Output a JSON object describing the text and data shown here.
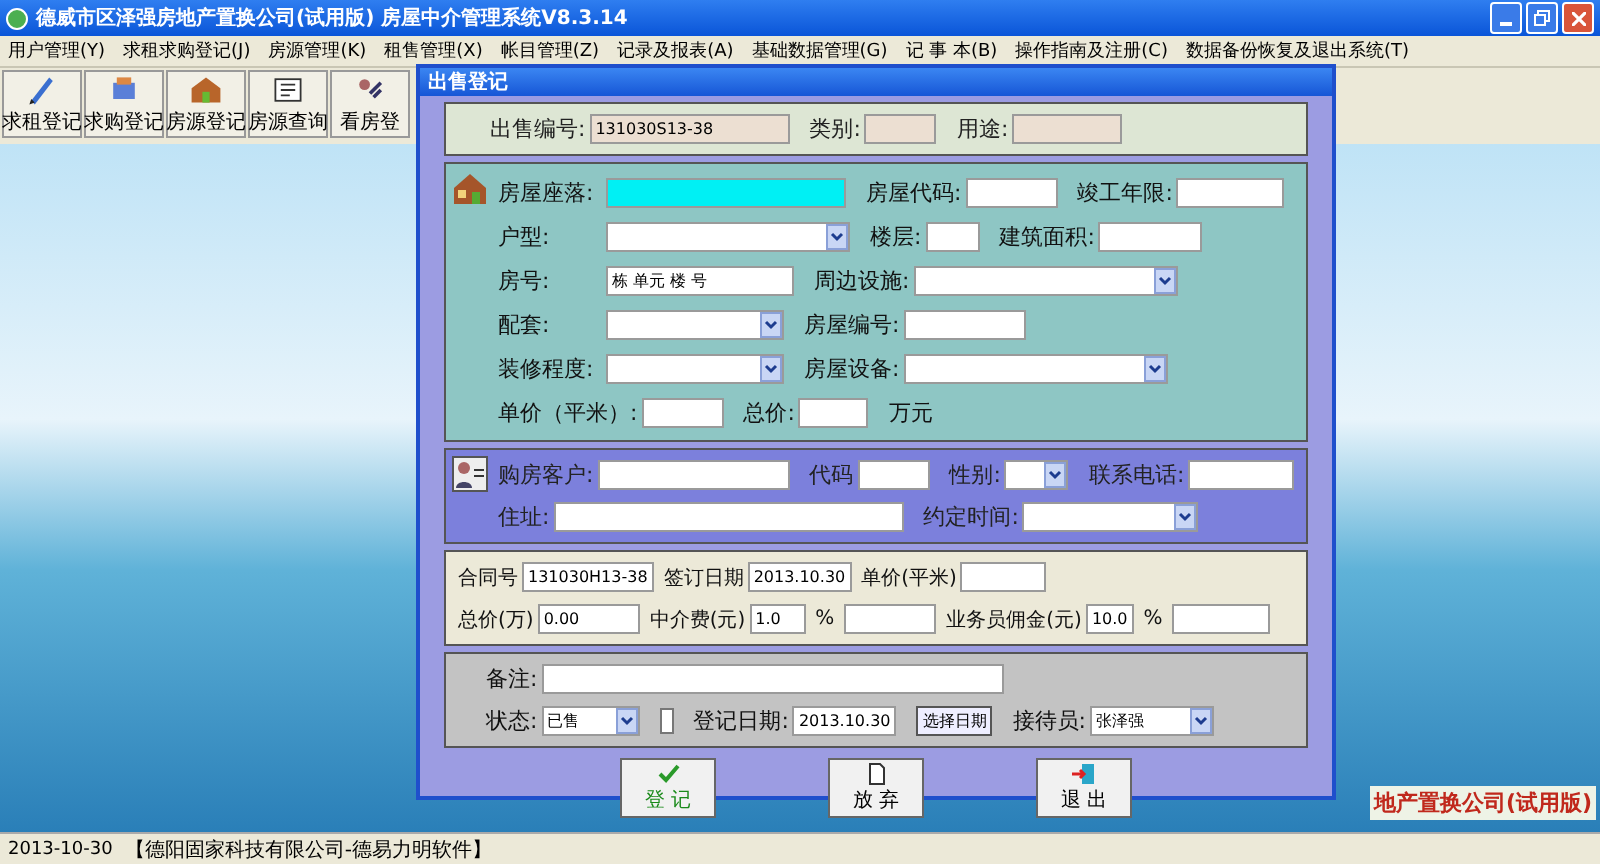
{
  "window": {
    "title": "德威市区泽强房地产置换公司(试用版) 房屋中介管理系统V8.3.14"
  },
  "menu": [
    "用户管理(Y)",
    "求租求购登记(J)",
    "房源管理(K)",
    "租售管理(X)",
    "帐目管理(Z)",
    "记录及报表(A)",
    "基础数据管理(G)",
    "记 事 本(B)",
    "操作指南及注册(C)",
    "数据备份恢复及退出系统(T)"
  ],
  "toolbar": [
    "求租登记",
    "求购登记",
    "房源登记",
    "房源查询",
    "看房登"
  ],
  "banner": "地产置换公司(试用版)",
  "dialog": {
    "title": "出售登记",
    "sections": [
      {
        "kind": "header",
        "lines": [
          [
            {
              "kind": "field",
              "label": "出售编号:",
              "value": "131030S13-38",
              "focused": false
            },
            {
              "kind": "field",
              "label": "类别:",
              "focused": false
            },
            {
              "kind": "field",
              "label": "用途:",
              "focused": false
            }
          ]
        ]
      },
      {
        "kind": "house",
        "lines": [
          [
            {
              "kind": "field",
              "label": "房屋座落:",
              "focused": true
            },
            {
              "kind": "field",
              "label": "房屋代码:",
              "focused": false
            },
            {
              "kind": "field",
              "label": "竣工年限:",
              "focused": false
            }
          ],
          [
            {
              "kind": "combo",
              "label": "户型:"
            },
            {
              "kind": "field",
              "label": "楼层:",
              "focused": false
            },
            {
              "kind": "field",
              "label": "建筑面积:",
              "focused": false
            }
          ],
          [
            {
              "kind": "field",
              "label": "房号:",
              "value": "栋 单元 楼 号",
              "focused": false
            },
            {
              "kind": "combo",
              "label": "周边设施:"
            }
          ],
          [
            {
              "kind": "combo",
              "label": "配套:"
            },
            {
              "kind": "field",
              "label": "房屋编号:",
              "focused": false
            }
          ],
          [
            {
              "kind": "combo",
              "label": "装修程度:"
            },
            {
              "kind": "combo",
              "label": "房屋设备:"
            }
          ],
          [
            {
              "kind": "field",
              "label": "单价（平米）:",
              "focused": false
            },
            {
              "kind": "field",
              "label": "总价:",
              "focused": false
            },
            {
              "kind": "text",
              "label": "万元"
            }
          ]
        ]
      },
      {
        "kind": "customer",
        "lines": [
          [
            {
              "kind": "field",
              "label": "购房客户:",
              "focused": false
            },
            {
              "kind": "field",
              "label": "代码",
              "focused": false
            },
            {
              "kind": "combo",
              "label": "性别:"
            },
            {
              "kind": "field",
              "label": "联系电话:",
              "focused": false
            }
          ],
          [
            {
              "kind": "field",
              "label": "住址:",
              "focused": false
            },
            {
              "kind": "combo",
              "label": "约定时间:"
            }
          ]
        ]
      },
      {
        "kind": "contract",
        "lines": [
          [
            {
              "kind": "field",
              "label": "合同号",
              "value": "131030H13-38",
              "focused": false
            },
            {
              "kind": "field",
              "label": "签订日期",
              "value": "2013.10.30",
              "focused": false
            },
            {
              "kind": "field",
              "label": "单价(平米)",
              "focused": false
            }
          ],
          [
            {
              "kind": "field",
              "label": "总价(万)",
              "value": "0.00",
              "focused": false
            },
            {
              "kind": "field",
              "label": "中介费(元)",
              "value": "1.0",
              "focused": false
            },
            {
              "kind": "text",
              "label": "%"
            },
            {
              "kind": "field",
              "focused": false
            },
            {
              "kind": "field",
              "label": "业务员佣金(元)",
              "value": "10.0",
              "focused": false
            },
            {
              "kind": "text",
              "label": "%"
            },
            {
              "kind": "field",
              "focused": false
            }
          ]
        ]
      },
      {
        "kind": "state",
        "lines": [
          [
            {
              "kind": "field",
              "label": "备注:",
              "focused": false
            }
          ],
          [
            {
              "kind": "combo",
              "label": "状态:",
              "value": "已售"
            },
            {
              "kind": "spin"
            },
            {
              "kind": "field",
              "label": "登记日期:",
              "value": "2013.10.30",
              "focused": false
            },
            {
              "kind": "button",
              "label": "选择日期"
            },
            {
              "kind": "combo",
              "label": "接待员:",
              "value": "张泽强"
            }
          ]
        ]
      }
    ],
    "buttons": [
      {
        "kind": "confirm",
        "label": "登 记"
      },
      {
        "kind": "discard",
        "label": "放 弃"
      },
      {
        "kind": "exit",
        "label": "退 出"
      }
    ]
  },
  "status_bar": {
    "date": "2013-10-30",
    "company": "【德阳固家科技有限公司-德易力明软件】"
  }
}
